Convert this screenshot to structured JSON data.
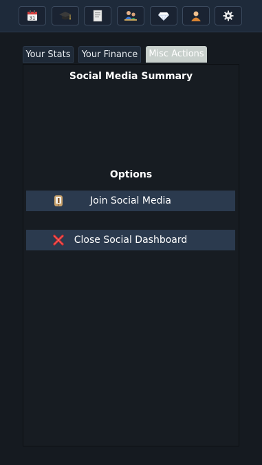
{
  "toolbar": {
    "buttons": [
      {
        "icon": "calendar-icon",
        "day": "31"
      },
      {
        "icon": "graduation-cap-icon"
      },
      {
        "icon": "document-icon"
      },
      {
        "icon": "people-icon"
      },
      {
        "icon": "diamond-icon"
      },
      {
        "icon": "person-icon"
      },
      {
        "icon": "gear-icon"
      }
    ]
  },
  "tabs": [
    {
      "label": "Your Stats",
      "active": false
    },
    {
      "label": "Your Finance",
      "active": false
    },
    {
      "label": "Misc Actions",
      "active": true
    }
  ],
  "panel": {
    "title": "Social Media Summary",
    "options_title": "Options",
    "actions": [
      {
        "label": "Join Social Media",
        "icon": "phone-icon"
      },
      {
        "label": "Close Social Dashboard",
        "icon": "red-x-icon"
      }
    ]
  },
  "colors": {
    "background": "#151a20",
    "topbar": "#1e2a3a",
    "action_bg": "#2b3a4e",
    "active_tab": "#c8d0cc"
  }
}
